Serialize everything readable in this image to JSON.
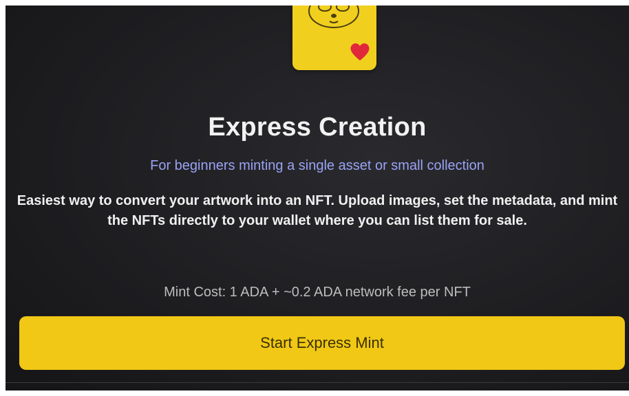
{
  "header": {
    "title": "Express Creation",
    "subtitle": "For beginners minting a single asset or small collection"
  },
  "body": {
    "description": "Easiest way to convert your artwork into an NFT. Upload images, set the metadata, and mint the NFTs directly to your wallet where you can list them for sale.",
    "mint_cost": "Mint Cost: 1 ADA + ~0.2 ADA network fee per NFT"
  },
  "actions": {
    "start_label": "Start Express Mint"
  },
  "colors": {
    "accent": "#f0c815",
    "subtitle": "#9aa3f5",
    "heart": "#e0283a"
  },
  "icons": {
    "mascot": "sloth-face-icon",
    "heart": "heart-icon"
  }
}
